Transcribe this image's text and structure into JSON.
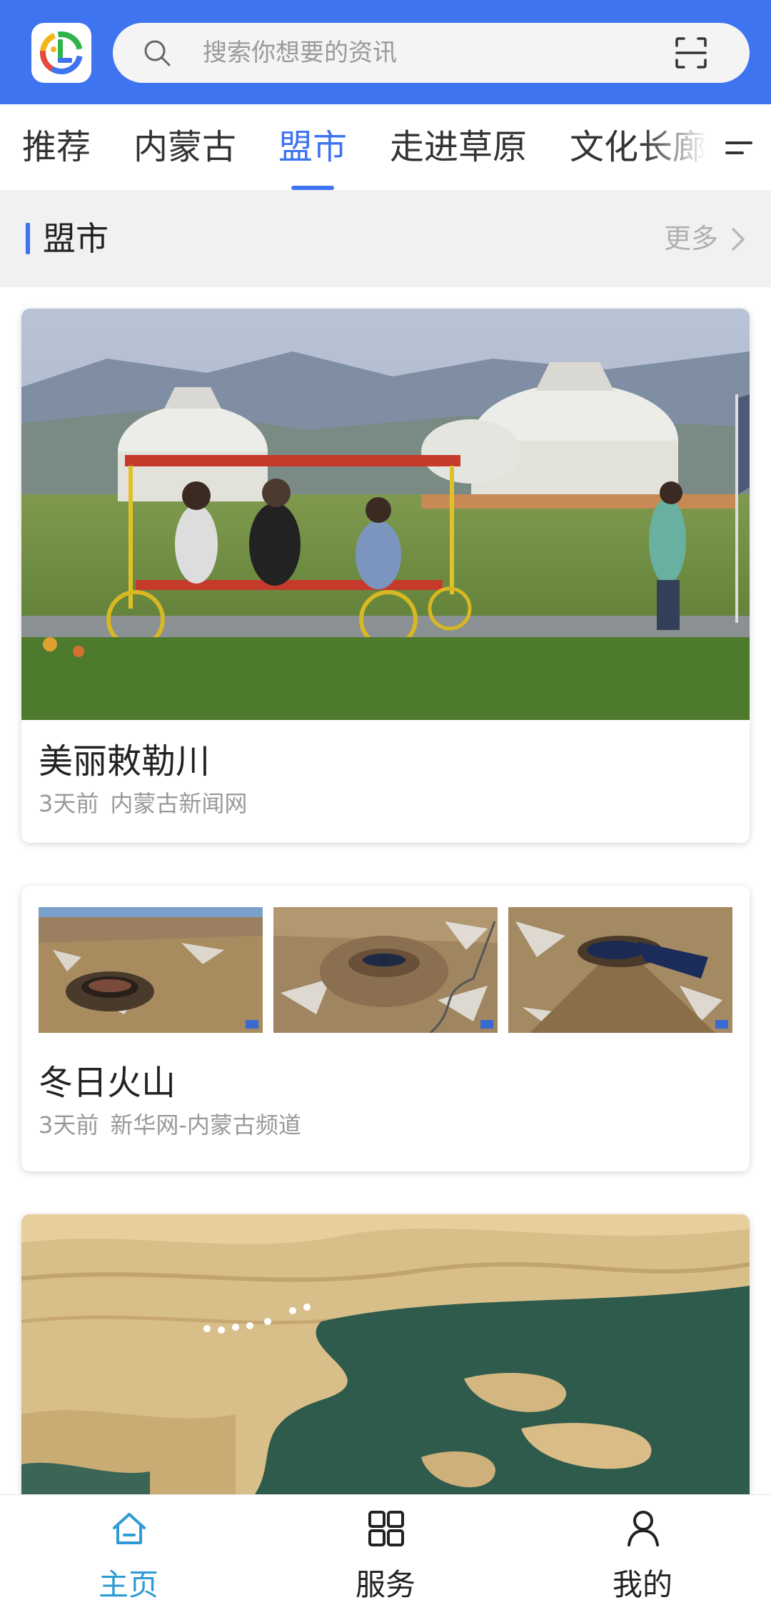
{
  "header": {
    "search_placeholder": "搜索你想要的资讯",
    "brand_color": "#3f74f0"
  },
  "tabs": [
    {
      "label": "推荐",
      "active": false
    },
    {
      "label": "内蒙古",
      "active": false
    },
    {
      "label": "盟市",
      "active": true
    },
    {
      "label": "走进草原",
      "active": false
    },
    {
      "label": "文化长廊",
      "active": false
    }
  ],
  "section": {
    "title": "盟市",
    "more_label": "更多"
  },
  "articles": [
    {
      "title": "美丽敕勒川",
      "time": "3天前",
      "source": "内蒙古新闻网",
      "image": "yurts-grassland-quadricycle-photo"
    },
    {
      "title": "冬日火山",
      "time": "3天前",
      "source": "新华网-内蒙古频道",
      "images": [
        "volcano-crater-photo-1",
        "volcano-crater-photo-2",
        "volcano-crater-photo-3"
      ]
    },
    {
      "image": "desert-dunes-lakes-aerial-photo"
    }
  ],
  "bottom_nav": [
    {
      "label": "主页",
      "icon": "home-icon",
      "active": true
    },
    {
      "label": "服务",
      "icon": "grid-icon",
      "active": false
    },
    {
      "label": "我的",
      "icon": "user-icon",
      "active": false
    }
  ]
}
